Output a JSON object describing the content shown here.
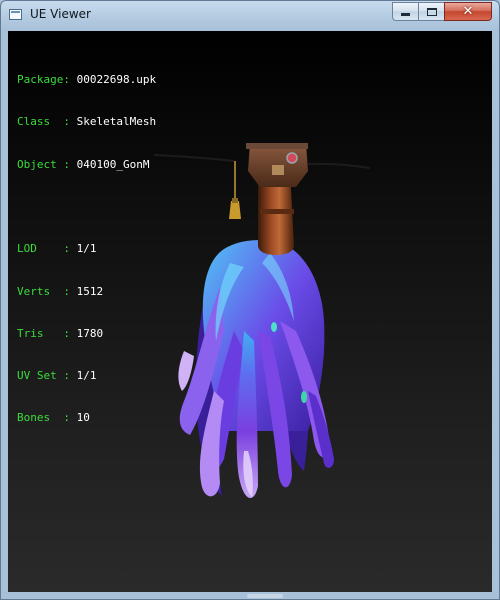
{
  "window": {
    "title": "UE Viewer",
    "icon": "window-app-icon",
    "controls": {
      "minimize_icon": "minimize-icon",
      "maximize_icon": "maximize-icon",
      "close_symbol": "✕"
    }
  },
  "info": {
    "package": {
      "label": "Package:",
      "value": "00022698.upk"
    },
    "class": {
      "label": "Class  :",
      "value": "SkeletalMesh"
    },
    "object": {
      "label": "Object :",
      "value": "040100_GonM"
    },
    "lod": {
      "label": "LOD    :",
      "value": "1/1"
    },
    "verts": {
      "label": "Verts  :",
      "value": "1512"
    },
    "tris": {
      "label": "Tris   :",
      "value": "1780"
    },
    "uvset": {
      "label": "UV Set :",
      "value": "1/1"
    },
    "bones": {
      "label": "Bones  :",
      "value": "10"
    }
  },
  "colors": {
    "label_green": "#3bdc3b",
    "value_white": "#ffffff",
    "hair_purple": "#7a3fe0",
    "hair_blue": "#3fa8f0",
    "hat_wood": "#7a3a1c"
  },
  "viewport": {
    "model_description_icon": "skeletal-mesh-hair-model"
  }
}
